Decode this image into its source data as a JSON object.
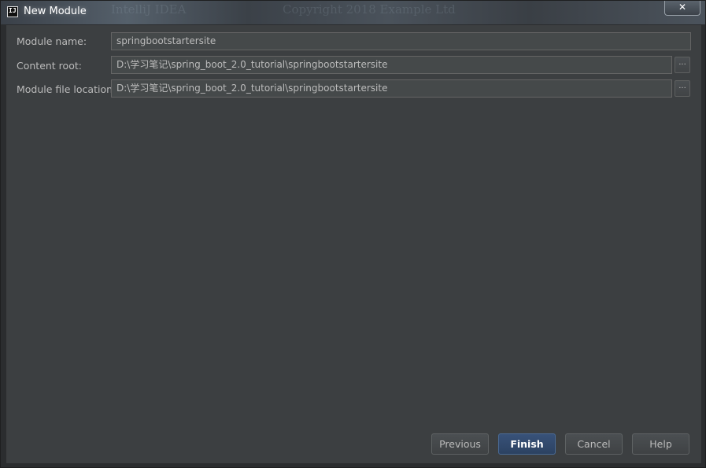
{
  "window": {
    "title": "New Module",
    "app_icon_text": "IJ",
    "close_glyph": "✕",
    "background_ghost_text": [
      "IntelliJ IDEA",
      "Copyright 2018 Example Ltd"
    ]
  },
  "form": {
    "module_name": {
      "label": "Module name:",
      "value": "springbootstartersite"
    },
    "content_root": {
      "label": "Content root:",
      "value": "D:\\学习笔记\\spring_boot_2.0_tutorial\\springbootstartersite",
      "browse_label": "..."
    },
    "module_file_location": {
      "label": "Module file location:",
      "value": "D:\\学习笔记\\spring_boot_2.0_tutorial\\springbootstartersite",
      "browse_label": "..."
    }
  },
  "buttons": {
    "previous": "Previous",
    "finish": "Finish",
    "cancel": "Cancel",
    "help": "Help"
  },
  "colors": {
    "panel_background": "#3c3f41",
    "field_background": "#45494a",
    "text": "#bbbbbb",
    "default_button": "#385279"
  }
}
